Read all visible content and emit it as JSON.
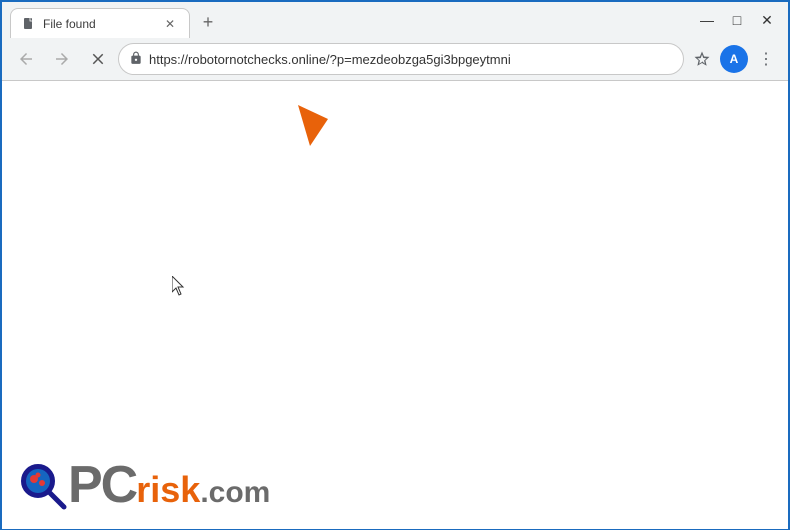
{
  "browser": {
    "tab": {
      "title": "File found",
      "favicon": "file-icon"
    },
    "new_tab_label": "+",
    "window_controls": {
      "minimize": "—",
      "maximize": "□",
      "close": "✕"
    },
    "nav": {
      "back_disabled": true,
      "forward_disabled": true,
      "refresh_label": "✕",
      "url": "https://robotornotchecks.online/?p=mezdeobzga5gi3bpgeytmni"
    },
    "toolbar": {
      "star_label": "☆",
      "profile_label": "A",
      "menu_label": "⋮"
    }
  },
  "content": {
    "empty": true
  },
  "watermark": {
    "pc_text": "PC",
    "risk_text": "risk",
    "dot_com": ".com"
  },
  "colors": {
    "accent_blue": "#1a6bbf",
    "arrow_orange": "#e8620a",
    "tab_bg": "#ffffff",
    "chrome_bg": "#f1f3f4"
  }
}
